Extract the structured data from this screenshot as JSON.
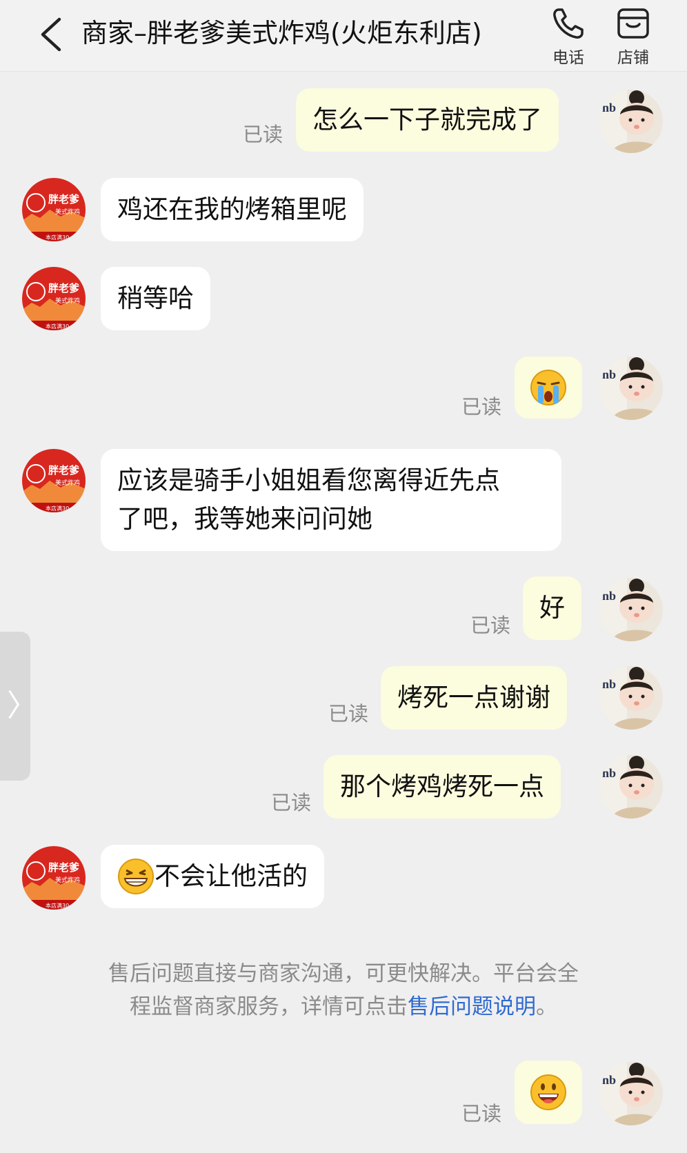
{
  "header": {
    "title": "商家–胖老爹美式炸鸡(火炬东利店)",
    "phone_label": "电话",
    "shop_label": "店铺"
  },
  "status": {
    "read": "已读"
  },
  "merchant_avatar": {
    "line1": "胖老爹",
    "line2": "美式炸鸡",
    "footer": "本店满30"
  },
  "user_avatar": {
    "text": "nb"
  },
  "messages": [
    {
      "sender": "me",
      "text": "怎么一下子就完成了"
    },
    {
      "sender": "merchant",
      "text": "鸡还在我的烤箱里呢"
    },
    {
      "sender": "merchant",
      "text": "稍等哈"
    },
    {
      "sender": "me",
      "emoji": "crying-face"
    },
    {
      "sender": "merchant",
      "lines": [
        "应该是骑手小姐姐看您离得近先点",
        "了吧，我等她来问问她"
      ]
    },
    {
      "sender": "me",
      "text": "好"
    },
    {
      "sender": "me",
      "text": "烤死一点谢谢"
    },
    {
      "sender": "me",
      "text": "那个烤鸡烤死一点"
    },
    {
      "sender": "merchant",
      "text": "不会让他活的",
      "emoji": "grinning-face"
    },
    {
      "sender": "me",
      "emoji": "smiling-face"
    }
  ],
  "notice": {
    "line1": "售后问题直接与商家沟通，可更快解决。平台会全",
    "line2_prefix": "程监督商家服务，详情可点击",
    "link": "售后问题说明",
    "line2_suffix": "。"
  },
  "side_tab": {
    "glyph": "〉"
  },
  "colors": {
    "background": "#efefef",
    "my_bubble": "#fcfcde",
    "their_bubble": "#ffffff",
    "link": "#2e6ad1",
    "merchant_red": "#d8271f"
  }
}
